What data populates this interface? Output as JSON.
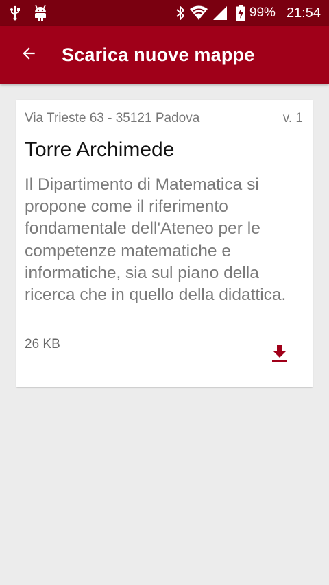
{
  "status_bar": {
    "battery_percent": "99%",
    "time": "21:54",
    "icons": [
      "usb-icon",
      "android-icon",
      "bluetooth-icon",
      "wifi-icon",
      "cell-signal-icon",
      "battery-charging-icon"
    ]
  },
  "app_bar": {
    "title": "Scarica nuove mappe",
    "back_icon": "arrow-back-icon"
  },
  "map_card": {
    "address": "Via Trieste 63 - 35121 Padova",
    "version": "v. 1",
    "title": "Torre Archimede",
    "description": "Il Dipartimento di Matematica si propone come il riferimento fondamentale dell'Ateneo per le competenze matematiche e informatiche, sia sul piano della ricerca che in quello della didattica.",
    "size": "26 KB",
    "download_icon": "download-icon"
  },
  "colors": {
    "status_bar": "#7a0010",
    "app_bar": "#a00019",
    "accent": "#a00019",
    "background": "#ececec"
  }
}
